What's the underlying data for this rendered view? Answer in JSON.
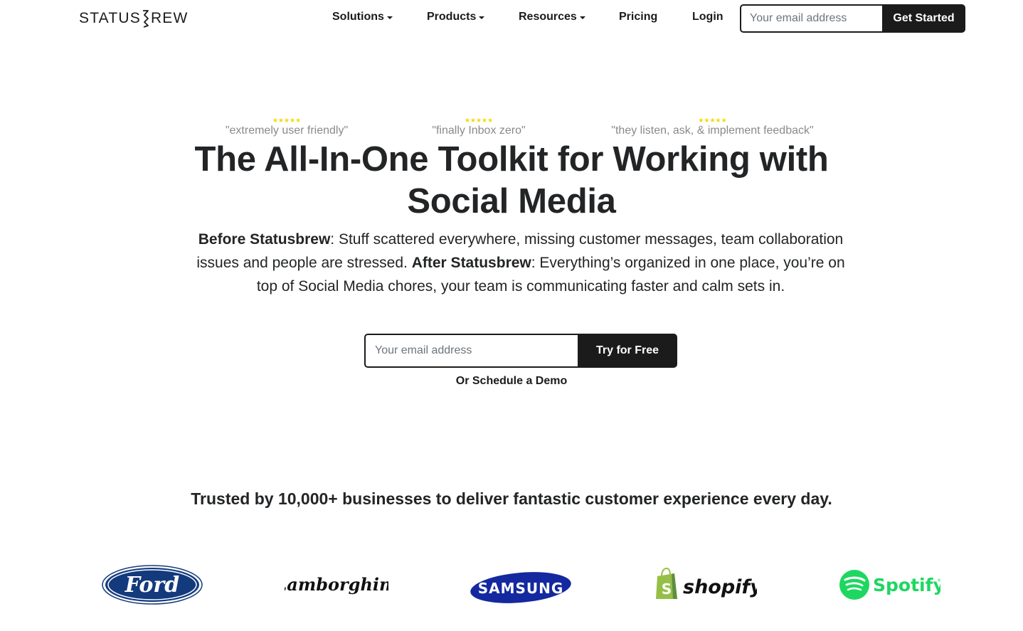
{
  "header": {
    "brand": "STATUSBREW",
    "brand_left": "STATUS",
    "brand_right": "REW",
    "nav": [
      {
        "label": "Solutions",
        "has_dropdown": true
      },
      {
        "label": "Products",
        "has_dropdown": true
      },
      {
        "label": "Resources",
        "has_dropdown": true
      },
      {
        "label": "Pricing",
        "has_dropdown": false
      },
      {
        "label": "Login",
        "has_dropdown": false
      }
    ],
    "email_placeholder": "Your email address",
    "cta_label": "Get Started"
  },
  "testimonials": [
    {
      "stars": "★★★★★",
      "rating": 5,
      "quote": "\"extremely user friendly\""
    },
    {
      "stars": "★★★★★",
      "rating": 5,
      "quote": "\"finally Inbox zero\""
    },
    {
      "stars": "★★★★★",
      "rating": 5,
      "quote": "\"they listen, ask, & implement feedback\""
    }
  ],
  "hero": {
    "title_line1": "The All-In-One Toolkit for Working with",
    "title_line2": "Social Media",
    "before_label": "Before Statusbrew",
    "before_text": ": Stuff scattered everywhere, missing customer messages, team collaboration issues and people are stressed. ",
    "after_label": "After Statusbrew",
    "after_text": ": Everything’s organized in one place, you’re on top of Social Media chores, your team is communicating faster and calm sets in.",
    "email_placeholder": "Your email address",
    "cta_label": "Try for Free",
    "demo_link": "Or Schedule a Demo"
  },
  "trusted": {
    "text": "Trusted by 10,000+ businesses to deliver fantastic customer experience every day."
  },
  "logos": [
    {
      "name": "Ford",
      "text": "Ford",
      "color": "#133a7c"
    },
    {
      "name": "Lamborghini",
      "text": "Lamborghini",
      "color": "#111111"
    },
    {
      "name": "Samsung",
      "text": "SAMSUNG",
      "color": "#1428a0"
    },
    {
      "name": "Shopify",
      "text": "shopify",
      "color": "#95bf47"
    },
    {
      "name": "Spotify",
      "text": "Spotify",
      "color": "#1ed760"
    }
  ],
  "colors": {
    "primary_dark": "#1b1b1b",
    "star": "#f5d800",
    "muted_text": "#8a8a8a"
  }
}
